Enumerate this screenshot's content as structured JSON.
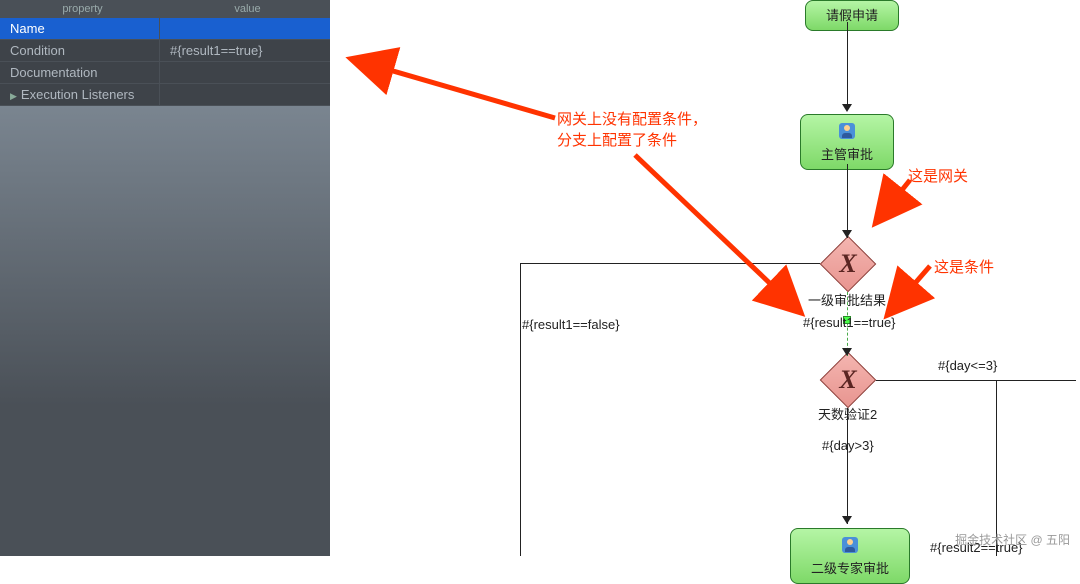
{
  "panel": {
    "headers": {
      "property": "property",
      "value": "value"
    },
    "rows": [
      {
        "label": "Name",
        "value": ""
      },
      {
        "label": "Condition",
        "value": "#{result1==true}"
      },
      {
        "label": "Documentation",
        "value": ""
      },
      {
        "label": "Execution Listeners",
        "value": ""
      }
    ]
  },
  "tasks": {
    "apply": "请假申请",
    "supervisor": "主管审批",
    "expert": "二级专家审批"
  },
  "gateways": {
    "result1": "一级审批结果",
    "days": "天数验证2"
  },
  "flows": {
    "condFalse": "#{result1==false}",
    "condTrue": "#{result1==true}",
    "dayGt": "#{day>3}",
    "dayLe": "#{day<=3}",
    "result2": "#{result2==true}"
  },
  "annotations": {
    "line1": "网关上没有配置条件，",
    "line2": "分支上配置了条件",
    "gateway": "这是网关",
    "condition": "这是条件"
  },
  "watermark": "掘金技术社区 @ 五阳"
}
